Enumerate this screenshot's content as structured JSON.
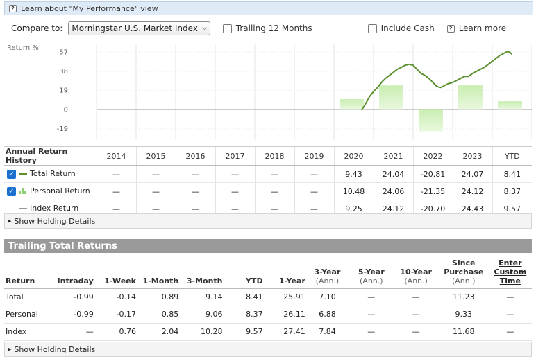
{
  "learn_bar": {
    "icon": "help-icon",
    "text": "Learn about \"My Performance\" view"
  },
  "controls": {
    "compare_label": "Compare to:",
    "compare_value": "Morningstar U.S. Market Index",
    "trailing_label": "Trailing 12 Months",
    "cash_label": "Include Cash",
    "learn_more": "Learn more"
  },
  "chart_data": {
    "type": "bar",
    "ylabel": "Return %",
    "yticks": [
      57,
      38,
      19,
      0,
      -19
    ],
    "ylim": [
      -30,
      62
    ],
    "categories": [
      "2014",
      "2015",
      "2016",
      "2017",
      "2018",
      "2019",
      "2020",
      "2021",
      "2022",
      "2023",
      "YTD"
    ],
    "series": [
      {
        "name": "Personal Return",
        "values": [
          null,
          null,
          null,
          null,
          null,
          null,
          10.48,
          24.06,
          -21.35,
          24.12,
          8.37
        ],
        "color": "#b6e39a"
      },
      {
        "name": "Total Return",
        "type": "line",
        "color": "#5b8f2e",
        "points": [
          [
            6.7,
            -0.5
          ],
          [
            6.8,
            6
          ],
          [
            6.9,
            13
          ],
          [
            7.0,
            18
          ],
          [
            7.1,
            22
          ],
          [
            7.2,
            27
          ],
          [
            7.3,
            31
          ],
          [
            7.4,
            34
          ],
          [
            7.5,
            37
          ],
          [
            7.6,
            40
          ],
          [
            7.7,
            42
          ],
          [
            7.8,
            44
          ],
          [
            7.9,
            45
          ],
          [
            8.0,
            44
          ],
          [
            8.1,
            40
          ],
          [
            8.2,
            36
          ],
          [
            8.3,
            34
          ],
          [
            8.4,
            31
          ],
          [
            8.5,
            27
          ],
          [
            8.6,
            23
          ],
          [
            8.7,
            22
          ],
          [
            8.8,
            24
          ],
          [
            8.9,
            26
          ],
          [
            9.0,
            27
          ],
          [
            9.1,
            29
          ],
          [
            9.2,
            31
          ],
          [
            9.3,
            33
          ],
          [
            9.4,
            33
          ],
          [
            9.5,
            36
          ],
          [
            9.6,
            38
          ],
          [
            9.7,
            40
          ],
          [
            9.8,
            42
          ],
          [
            9.9,
            45
          ],
          [
            10.0,
            48
          ],
          [
            10.1,
            51
          ],
          [
            10.2,
            54
          ],
          [
            10.3,
            56
          ],
          [
            10.4,
            58
          ],
          [
            10.5,
            55
          ]
        ]
      }
    ]
  },
  "annual": {
    "title": "Annual Return History",
    "years": [
      "2014",
      "2015",
      "2016",
      "2017",
      "2018",
      "2019",
      "2020",
      "2021",
      "2022",
      "2023",
      "YTD"
    ],
    "rows": [
      {
        "checked": true,
        "check_glyph": "✓",
        "legend": "line-dark",
        "label": "Total Return",
        "values": [
          "—",
          "—",
          "—",
          "—",
          "—",
          "—",
          "9.43",
          "24.04",
          "-20.81",
          "24.07",
          "8.41"
        ]
      },
      {
        "checked": true,
        "check_glyph": "✓",
        "legend": "bars-green",
        "label": "Personal Return",
        "values": [
          "—",
          "—",
          "—",
          "—",
          "—",
          "—",
          "10.48",
          "24.06",
          "-21.35",
          "24.12",
          "8.37"
        ]
      },
      {
        "checked": false,
        "check_glyph": "",
        "legend": "line-gray",
        "label": "Index Return",
        "values": [
          "—",
          "—",
          "—",
          "—",
          "—",
          "—",
          "9.25",
          "24.12",
          "-20.70",
          "24.43",
          "9.57"
        ]
      }
    ]
  },
  "holding_details": "Show Holding Details",
  "trailing": {
    "title": "Trailing Total Returns",
    "headers": [
      {
        "main": "Return",
        "sub": ""
      },
      {
        "main": "Intraday",
        "sub": ""
      },
      {
        "main": "1-Week",
        "sub": ""
      },
      {
        "main": "1-Month",
        "sub": ""
      },
      {
        "main": "3-Month",
        "sub": ""
      },
      {
        "main": "YTD",
        "sub": ""
      },
      {
        "main": "1-Year",
        "sub": ""
      },
      {
        "main": "3-Year",
        "sub": "(Ann.)"
      },
      {
        "main": "5-Year",
        "sub": "(Ann.)"
      },
      {
        "main": "10-Year",
        "sub": "(Ann.)"
      },
      {
        "main": "Since Purchase",
        "sub": "(Ann.)"
      },
      {
        "main": "Enter Custom Time",
        "sub": ""
      }
    ],
    "rows": [
      {
        "label": "Total",
        "values": [
          "-0.99",
          "-0.14",
          "0.89",
          "9.14",
          "8.41",
          "25.91",
          "7.10",
          "—",
          "—",
          "11.23",
          "—"
        ]
      },
      {
        "label": "Personal",
        "values": [
          "-0.99",
          "-0.17",
          "0.85",
          "9.06",
          "8.37",
          "26.11",
          "6.88",
          "—",
          "—",
          "9.33",
          "—"
        ]
      },
      {
        "label": "Index",
        "values": [
          "—",
          "0.76",
          "2.04",
          "10.28",
          "9.57",
          "27.41",
          "7.84",
          "—",
          "—",
          "11.68",
          "—"
        ]
      }
    ]
  }
}
